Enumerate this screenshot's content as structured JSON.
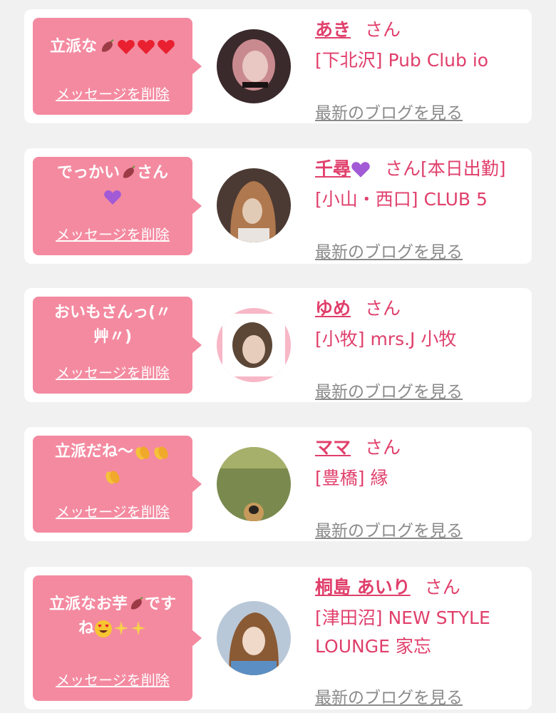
{
  "common": {
    "delete_label": "メッセージを削除",
    "blog_label": "最新のブログを見る",
    "san": "さん"
  },
  "cards": [
    {
      "message_line1": "立派な",
      "message_icons": [
        "sweet-potato-icon",
        "heart-icon",
        "heart-icon",
        "heart-icon"
      ],
      "name": "あき",
      "san": "さん",
      "name_suffix": "",
      "shop": "[下北沢] Pub Club io",
      "avatar_colors": [
        "#3a2a2c",
        "#c98a8f",
        "#e9c7c2"
      ]
    },
    {
      "message_line1": "でっかい",
      "message_line1_after": "さん",
      "message_icons": [
        "sweet-potato-icon",
        "purple-heart-icon"
      ],
      "name": "千尋",
      "name_icon": "purple-heart-icon",
      "san": "さん",
      "name_suffix": "[本日出勤]",
      "shop": "[小山・西口] CLUB 5",
      "avatar_colors": [
        "#4b3a33",
        "#b0784e",
        "#e2cbb6"
      ]
    },
    {
      "message_line1": "おいもさんっ(〃",
      "message_line2": "艸〃)",
      "name": "ゆめ",
      "san": "さん",
      "name_suffix": "",
      "shop": "[小牧] mrs.J 小牧",
      "avatar_colors": [
        "#f7b7c6",
        "#5c4636",
        "#e7cdbc"
      ]
    },
    {
      "message_line1": "立派だね〜",
      "message_icons": [
        "clapping-hands-icon",
        "clapping-hands-icon",
        "clapping-hands-icon"
      ],
      "name": "ママ",
      "san": "さん",
      "name_suffix": "",
      "shop": "[豊橋] 縁",
      "avatar_colors": [
        "#7a8a4e",
        "#a7b06a",
        "#c79a5b"
      ]
    },
    {
      "message_line1": "立派なお芋",
      "message_line1_after": "です",
      "message_line2": "ね",
      "message_icons": [
        "sweet-potato-icon",
        "heart-eyes-icon",
        "sparkles-icon",
        "sparkles-icon"
      ],
      "name": "桐島 あいり",
      "san": "さん",
      "name_suffix": "",
      "shop_line1": "[津田沼] NEW STYLE",
      "shop_line2": "LOUNGE 家忘",
      "avatar_colors": [
        "#b9c8d8",
        "#8a5a35",
        "#f0d9c8"
      ]
    }
  ]
}
